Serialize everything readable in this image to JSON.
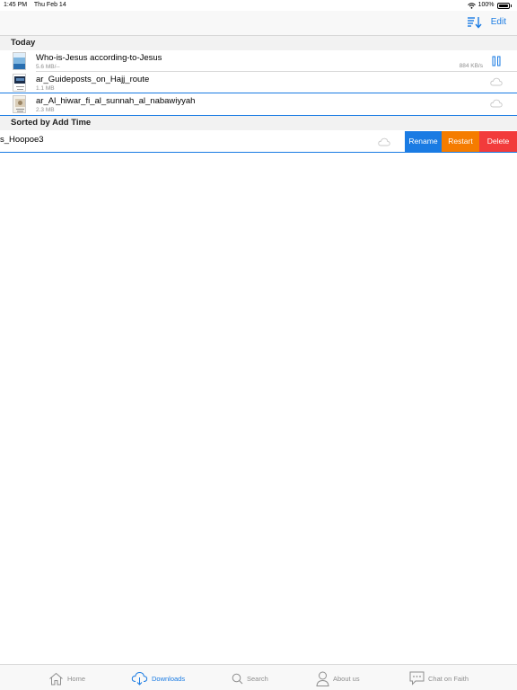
{
  "status": {
    "time": "1:45 PM",
    "date": "Thu Feb 14",
    "battery": "100%"
  },
  "nav": {
    "edit_label": "Edit",
    "sort_icon": "sort-download-icon"
  },
  "sections": {
    "today": "Today",
    "sorted": "Sorted by Add Time"
  },
  "rows": [
    {
      "title": "Who-is-Jesus according-to-Jesus",
      "sub": "5.6 MB/--",
      "speed": "884 KB/s",
      "action_icon": "pause-icon"
    },
    {
      "title": "ar_Guideposts_on_Hajj_route",
      "sub": "1.1 MB",
      "action_icon": "cloud-icon"
    },
    {
      "title": "ar_Al_hiwar_fi_al_sunnah_al_nabawiyyah",
      "sub": "2.3 MB",
      "action_icon": "cloud-icon"
    }
  ],
  "swipe_row": {
    "title": "s_Hoopoe3"
  },
  "actions": {
    "rename": "Rename",
    "restart": "Restart",
    "delete": "Delete"
  },
  "tabs": [
    {
      "label": "Home",
      "icon": "home-icon"
    },
    {
      "label": "Downloads",
      "icon": "cloud-download-icon"
    },
    {
      "label": "Search",
      "icon": "search-icon"
    },
    {
      "label": "About us",
      "icon": "person-icon"
    },
    {
      "label": "Chat on Faith",
      "icon": "chat-icon"
    }
  ],
  "colors": {
    "accent": "#1a7be3",
    "restart": "#f57c00",
    "delete": "#f23b3b"
  }
}
